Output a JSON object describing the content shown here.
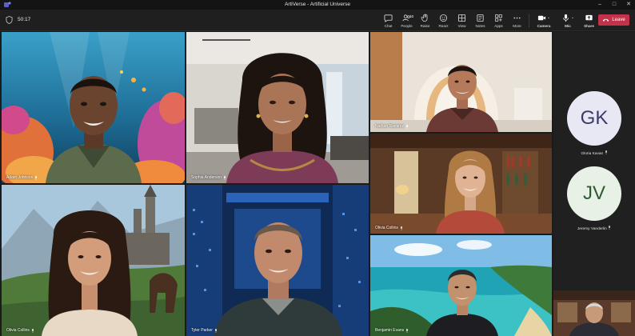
{
  "window": {
    "title": "ArtiVerse - Artificial Universe"
  },
  "toolbar": {
    "timer": "50:17",
    "chat_label": "Chat",
    "people_label": "People",
    "people_count": "10",
    "raise_label": "Raise",
    "react_label": "React",
    "view_label": "View",
    "notes_label": "Notes",
    "apps_label": "Apps",
    "more_label": "More",
    "camera_label": "Camera",
    "mic_label": "Mic",
    "share_label": "Share",
    "leave_label": "Leave"
  },
  "tiles": [
    {
      "name": "Adam Johnson"
    },
    {
      "name": "Sophia Anderson"
    },
    {
      "name": "Nathan Ramirez"
    },
    {
      "name": "Olivia Collins"
    },
    {
      "name": "Olivia Collins"
    },
    {
      "name": "Tyler Parker"
    },
    {
      "name": "Benjamin Evans"
    }
  ],
  "side_participants": [
    {
      "initials": "GK",
      "name": "Gloria Kavan"
    },
    {
      "initials": "JV",
      "name": "Jeremy Vanderlin"
    }
  ],
  "colors": {
    "leave": "#c4314b",
    "avatar_bg": "#e8e8f4",
    "avatar_text": "#3a3a6b",
    "speaking_outline": "#9ea2ff"
  }
}
